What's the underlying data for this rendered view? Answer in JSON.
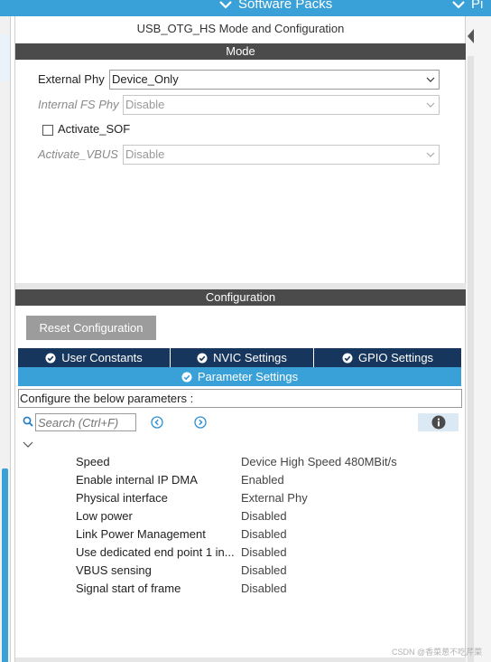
{
  "topbar": {
    "software_packs": "Software Packs",
    "pinout": "Pi"
  },
  "panel": {
    "title": "USB_OTG_HS Mode and Configuration"
  },
  "mode": {
    "header": "Mode",
    "external_phy_label": "External Phy",
    "external_phy_value": "Device_Only",
    "internal_fs_phy_label": "Internal FS Phy",
    "internal_fs_phy_value": "Disable",
    "activate_sof_label": "Activate_SOF",
    "activate_sof_checked": false,
    "activate_vbus_label": "Activate_VBUS",
    "activate_vbus_value": "Disable"
  },
  "configuration": {
    "header": "Configuration",
    "reset_label": "Reset Configuration",
    "tabs": [
      {
        "label": "User Constants"
      },
      {
        "label": "NVIC Settings"
      },
      {
        "label": "GPIO Settings"
      }
    ],
    "active_tab": "Parameter Settings",
    "configure_text": "Configure the below parameters :",
    "search_placeholder": "Search (Ctrl+F)",
    "parameters": [
      {
        "name": "Speed",
        "value": "Device High Speed 480MBit/s"
      },
      {
        "name": "Enable internal IP DMA",
        "value": "Enabled"
      },
      {
        "name": "Physical interface",
        "value": "External Phy"
      },
      {
        "name": "Low power",
        "value": "Disabled"
      },
      {
        "name": "Link Power Management",
        "value": "Disabled"
      },
      {
        "name": "Use dedicated end point 1 in...",
        "value": "Disabled"
      },
      {
        "name": "VBUS sensing",
        "value": "Disabled"
      },
      {
        "name": "Signal start of frame",
        "value": "Disabled"
      }
    ]
  },
  "watermark": "CSDN @香菜葱不吃芹菜",
  "colors": {
    "accent_blue": "#3aa1d8",
    "tab_navy": "#17365d",
    "header_gray": "#4b4b4b",
    "button_gray": "#9c9c9c"
  }
}
